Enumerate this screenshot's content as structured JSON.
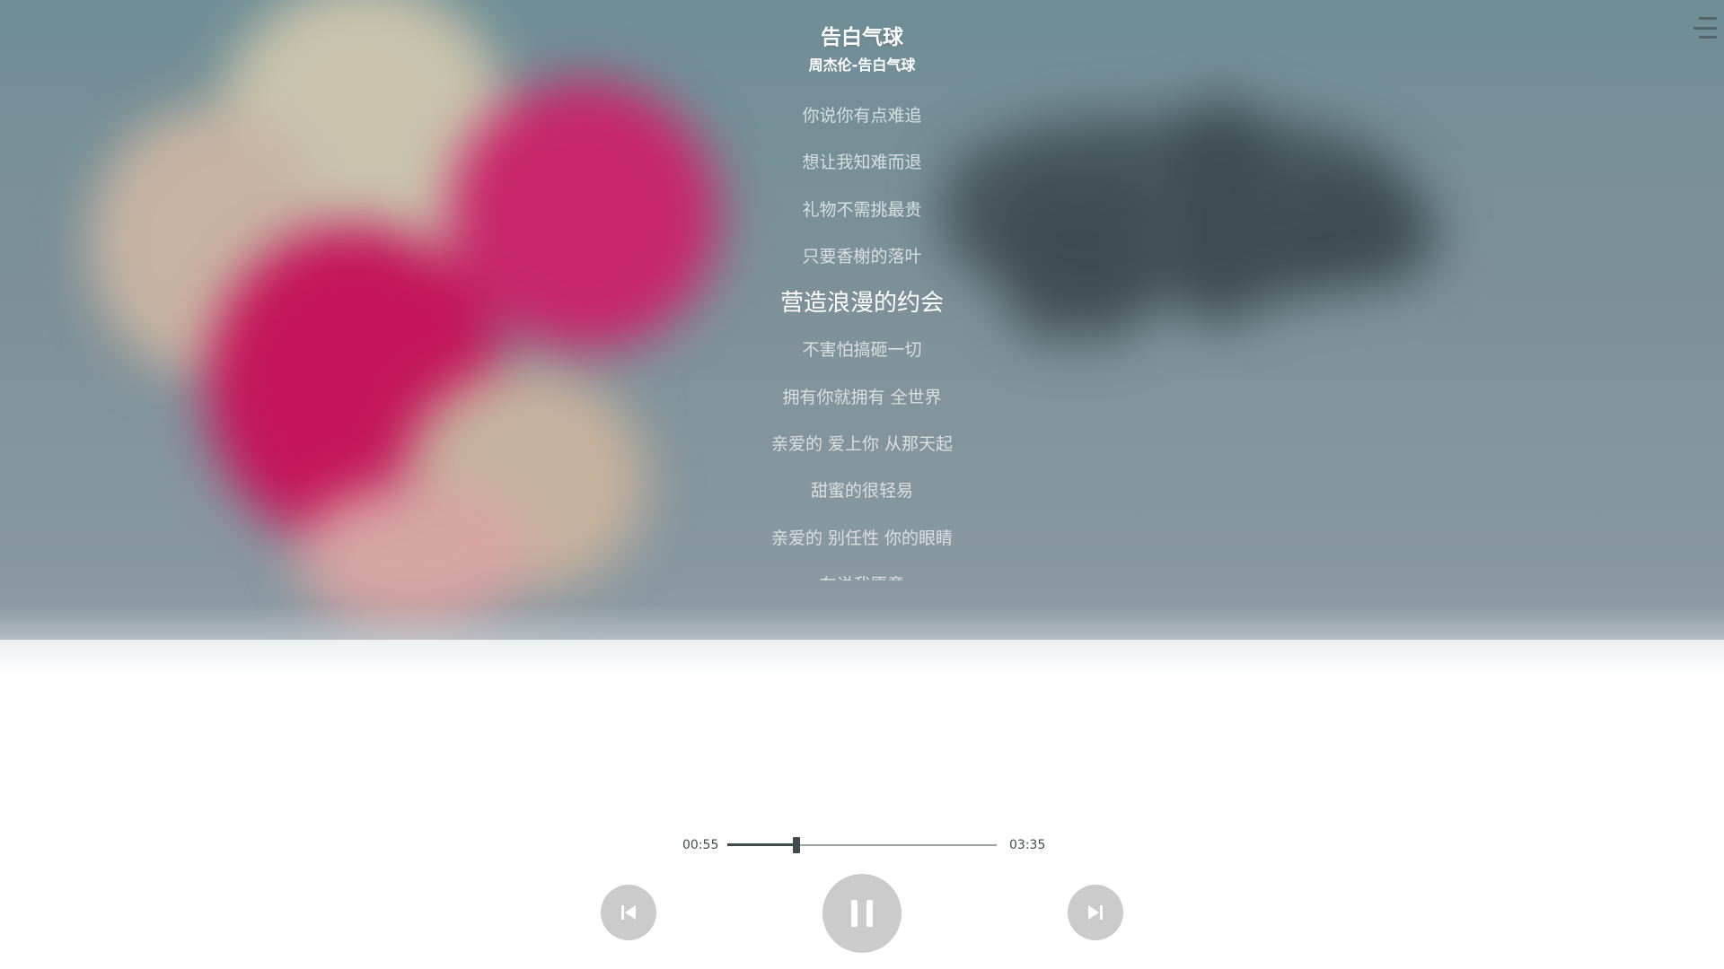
{
  "header": {
    "title": "告白气球",
    "subtitle": "周杰伦-告白气球",
    "menu_icon": "hamburger-menu-icon"
  },
  "lyrics": {
    "active_index": 4,
    "lines": [
      "你说你有点难追",
      "想让我知难而退",
      "礼物不需挑最贵",
      "只要香榭的落叶",
      "营造浪漫的约会",
      "不害怕搞砸一切",
      "拥有你就拥有 全世界",
      "亲爱的 爱上你 从那天起",
      "甜蜜的很轻易",
      "亲爱的 别任性 你的眼睛",
      "在说我愿意"
    ]
  },
  "player": {
    "current_time": "00:55",
    "total_time": "03:35",
    "progress_fraction": 0.256,
    "state": "playing",
    "controls": {
      "prev_icon": "skip-previous-icon",
      "play_pause_icon": "pause-icon",
      "next_icon": "skip-next-icon"
    }
  },
  "colors": {
    "active_lyric": "#ffffff",
    "inactive_lyric": "#e4e9ec",
    "progress_fill": "#3f4a4e",
    "progress_track": "#9aa1a5",
    "control_button": "#cbcbcb"
  }
}
